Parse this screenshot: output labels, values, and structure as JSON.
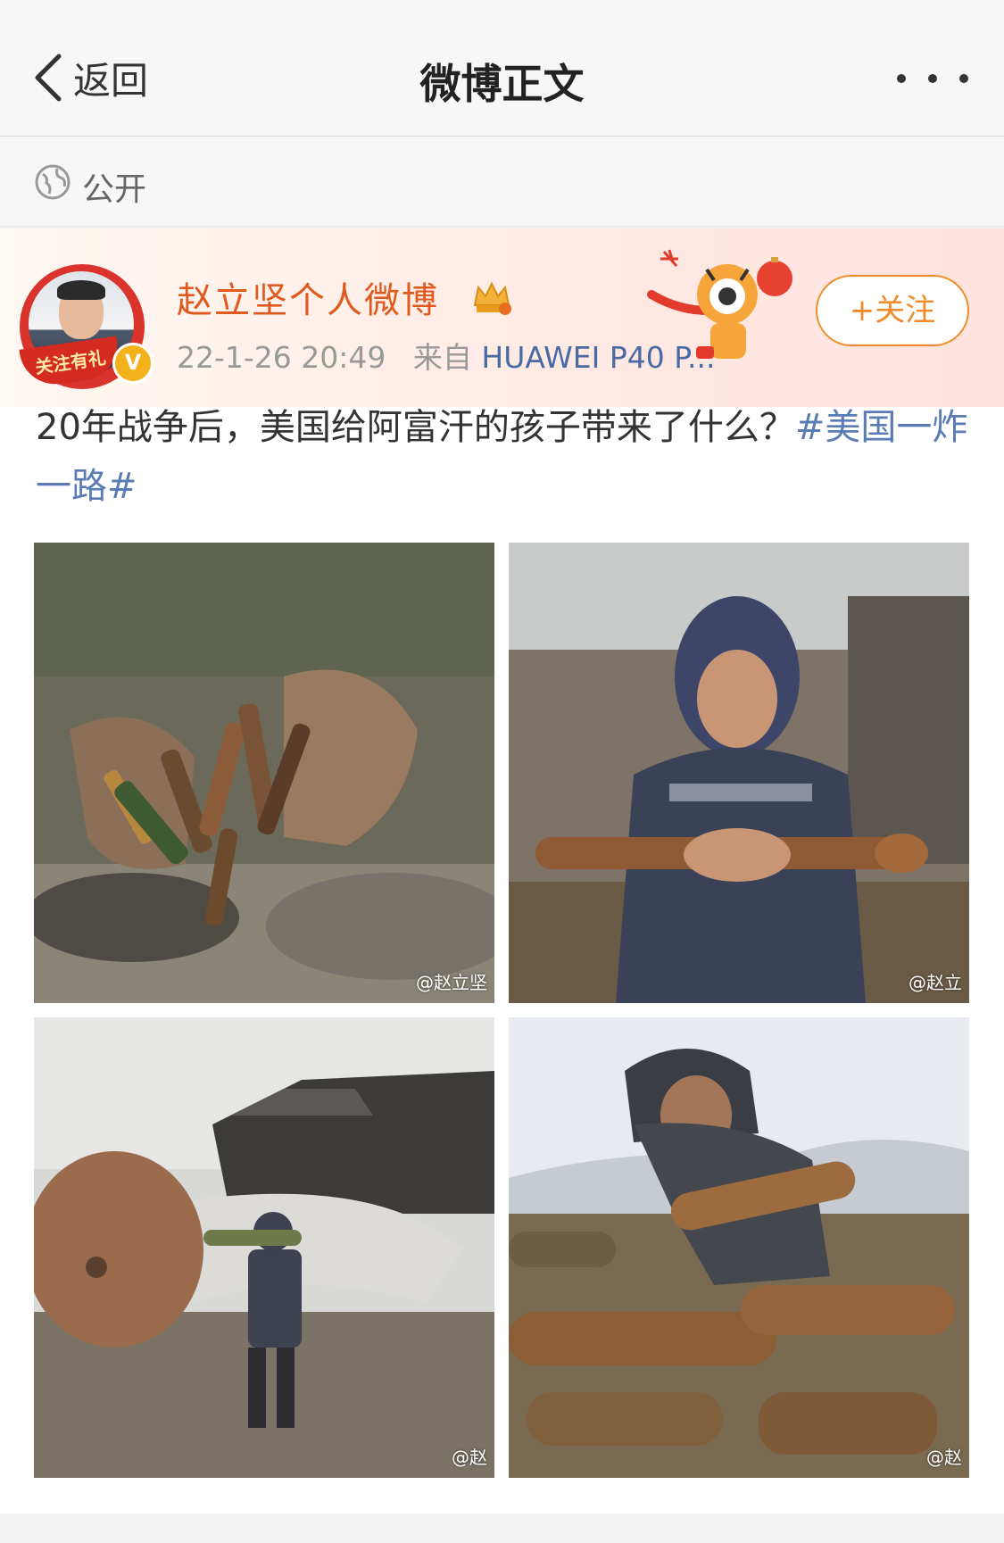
{
  "navbar": {
    "back_label": "返回",
    "title": "微博正文"
  },
  "visibility": {
    "label": "公开"
  },
  "post": {
    "avatar_banner": "关注有礼",
    "avatar_badge": "V",
    "username": "赵立坚个人微博",
    "timestamp": "22-1-26 20:49",
    "source_label": "来自",
    "source": "HUAWEI P40 P...",
    "follow_label": "+关注",
    "text": "20年战争后，美国给阿富汗的孩子带来了什么？",
    "hashtag": "#美国一炸一路#"
  },
  "images": [
    {
      "watermark": "@赵立坚"
    },
    {
      "watermark": "@赵立"
    },
    {
      "watermark": "@赵"
    },
    {
      "watermark": "@赵"
    }
  ]
}
